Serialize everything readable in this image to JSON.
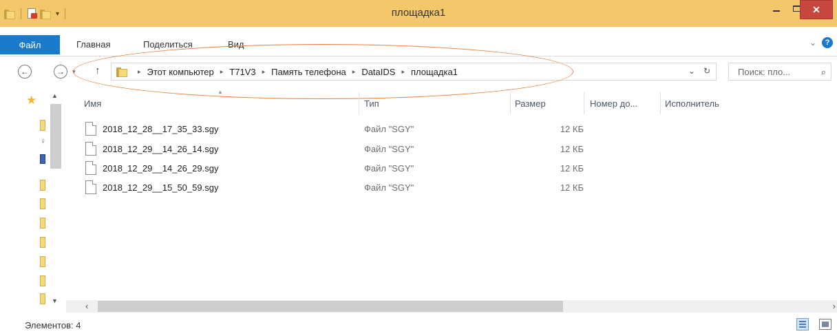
{
  "window": {
    "title": "площадка1",
    "qat_caret": "▾",
    "minimize": "",
    "maximize": "",
    "close": "✕"
  },
  "ribbon": {
    "file_tab": "Файл",
    "tabs": [
      "Главная",
      "Поделиться",
      "Вид"
    ],
    "expand": "⌄",
    "help": "?"
  },
  "nav": {
    "back": "←",
    "forward": "→",
    "recent": "▾",
    "up": "↑"
  },
  "address": {
    "breadcrumbs": [
      "Этот компьютер",
      "T71V3",
      "Память телефона",
      "DataIDS",
      "площадка1"
    ],
    "separator": "▸",
    "dropdown": "⌄",
    "refresh": "↻"
  },
  "search": {
    "placeholder": "Поиск: пло...",
    "icon": "⌕"
  },
  "columns": {
    "name": "Имя",
    "type": "Тип",
    "size": "Размер",
    "number": "Номер до...",
    "artist": "Исполнитель"
  },
  "files": [
    {
      "name": "2018_12_28__17_35_33.sgy",
      "type": "Файл \"SGY\"",
      "size": "12 КБ"
    },
    {
      "name": "2018_12_29__14_26_14.sgy",
      "type": "Файл \"SGY\"",
      "size": "12 КБ"
    },
    {
      "name": "2018_12_29__14_26_29.sgy",
      "type": "Файл \"SGY\"",
      "size": "12 КБ"
    },
    {
      "name": "2018_12_29__15_50_59.sgy",
      "type": "Файл \"SGY\"",
      "size": "12 КБ"
    }
  ],
  "scroll": {
    "up": "▲",
    "down": "▼",
    "left": "‹",
    "right": "›",
    "sort": "▲"
  },
  "status": {
    "items": "Элементов: 4"
  },
  "colors": {
    "titlebar": "#f2c86a",
    "accent": "#1979ca",
    "close": "#c7463e",
    "annotation": "#ed7d31"
  }
}
